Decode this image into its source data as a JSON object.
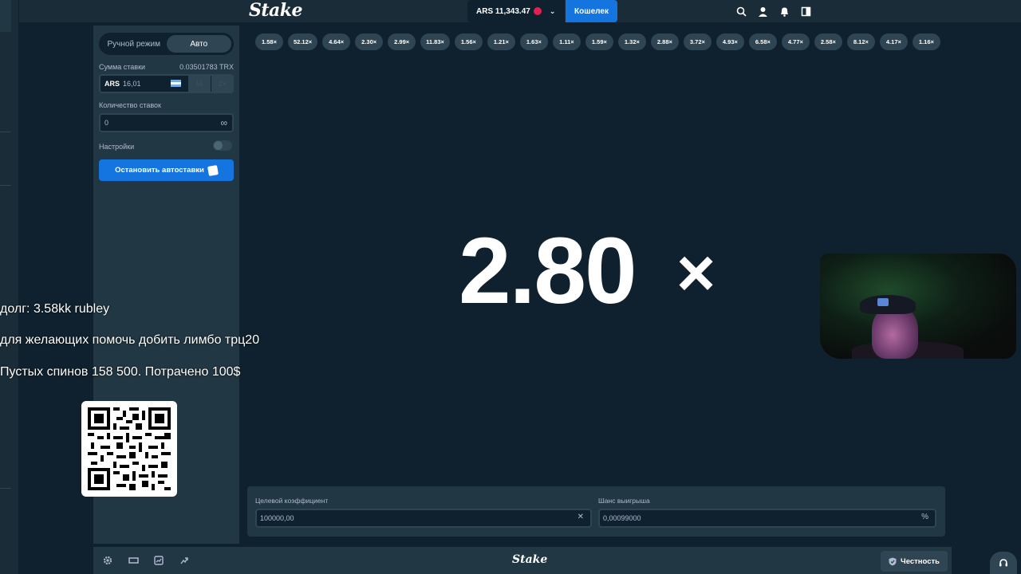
{
  "header": {
    "logo": "Stake",
    "balance": "ARS 11,343.47",
    "wallet_label": "Кошелек",
    "icons": [
      "search-icon",
      "user-icon",
      "bell-icon",
      "chat-toggle-icon"
    ]
  },
  "sidebar": {
    "mode_manual": "Ручной режим",
    "mode_auto": "Авто",
    "bet_amount_label": "Сумма ставки",
    "bet_amount_crypto": "0.03501783 TRX",
    "bet_currency": "ARS",
    "bet_value": "16,01",
    "half_label": "½",
    "double_label": "2×",
    "bets_count_label": "Количество ставок",
    "bets_count_value": "0",
    "infinity": "∞",
    "settings_label": "Настройки",
    "stop_autobet_label": "Остановить автоставки"
  },
  "game": {
    "history": [
      "1.58×",
      "52.12×",
      "4.64×",
      "2.30×",
      "2.99×",
      "11.83×",
      "1.56×",
      "1.21×",
      "1.63×",
      "1.11×",
      "1.59×",
      "1.32×",
      "2.88×",
      "3.72×",
      "4.93×",
      "6.58×",
      "4.77×",
      "2.58×",
      "8.12×",
      "4.17×",
      "1.16×"
    ],
    "multiplier": "2.80",
    "multiplier_suffix": "×",
    "target_label": "Целевой коэффициент",
    "target_value": "100000,00",
    "target_suffix": "✕",
    "chance_label": "Шанс выигрыша",
    "chance_value": "0,00099000",
    "chance_suffix": "%"
  },
  "toolbar": {
    "logo": "Stake",
    "fairness_label": "Честность",
    "icons": [
      "settings-icon",
      "theatre-mode-icon",
      "stats-icon",
      "popout-icon"
    ]
  },
  "overlay": {
    "line1": "долг: 3.58kk rubley",
    "line2": "для желающих помочь добить лимбо трц20",
    "line3": "Пустых спинов 158 500. Потрачено 100$"
  },
  "colors": {
    "background": "#0f212e",
    "panel": "#213743",
    "accent": "#1475e1",
    "chip": "#2f4553"
  }
}
